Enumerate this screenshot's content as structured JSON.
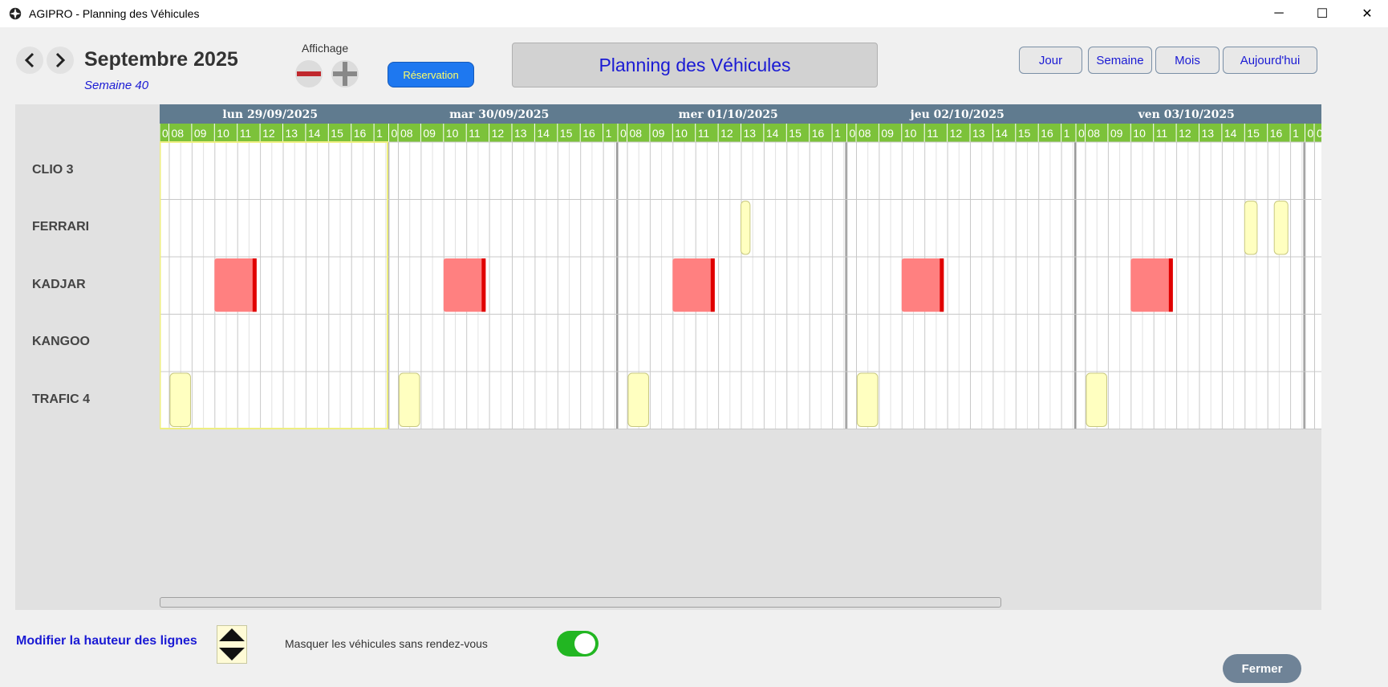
{
  "window": {
    "title": "AGIPRO - Planning des Véhicules",
    "controls": {
      "minimize": "─",
      "maximize": "☐",
      "close": "✕"
    }
  },
  "header": {
    "month_title": "Septembre 2025",
    "week_label": "Semaine 40",
    "display_label": "Affichage",
    "reservation_label": "Réservation",
    "planning_title": "Planning des Véhicules",
    "view_buttons": {
      "day": "Jour",
      "week": "Semaine",
      "month": "Mois",
      "today": "Aujourd'hui"
    }
  },
  "planning": {
    "days": [
      "lun 29/09/2025",
      "mar 30/09/2025",
      "mer 01/10/2025",
      "jeu 02/10/2025",
      "ven 03/10/2025"
    ],
    "hours": [
      "0",
      "08",
      "09",
      "10",
      "11",
      "12",
      "13",
      "14",
      "15",
      "16",
      "1"
    ],
    "vehicles": [
      "CLIO 3",
      "FERRARI",
      "KADJAR",
      "KANGOO",
      "TRAFIC 4"
    ],
    "reservations": [
      {
        "vehicle": "FERRARI",
        "day": 2,
        "start_hour": 13.0,
        "end_hour": 13.4,
        "status": "pending"
      },
      {
        "vehicle": "FERRARI",
        "day": 4,
        "start_hour": 15.0,
        "end_hour": 15.55,
        "status": "pending"
      },
      {
        "vehicle": "FERRARI",
        "day": 4,
        "start_hour": 16.3,
        "end_hour": 16.9,
        "status": "pending"
      },
      {
        "vehicle": "KADJAR",
        "day": 0,
        "start_hour": 10.0,
        "end_hour": 11.85,
        "status": "confirmed"
      },
      {
        "vehicle": "KADJAR",
        "day": 1,
        "start_hour": 10.0,
        "end_hour": 11.85,
        "status": "confirmed"
      },
      {
        "vehicle": "KADJAR",
        "day": 2,
        "start_hour": 10.0,
        "end_hour": 11.85,
        "status": "confirmed"
      },
      {
        "vehicle": "KADJAR",
        "day": 3,
        "start_hour": 10.0,
        "end_hour": 11.85,
        "status": "confirmed"
      },
      {
        "vehicle": "KADJAR",
        "day": 4,
        "start_hour": 10.0,
        "end_hour": 11.85,
        "status": "confirmed"
      },
      {
        "vehicle": "TRAFIC 4",
        "day": 0,
        "start_hour": 8.05,
        "end_hour": 8.95,
        "status": "pending"
      },
      {
        "vehicle": "TRAFIC 4",
        "day": 1,
        "start_hour": 8.05,
        "end_hour": 8.95,
        "status": "pending"
      },
      {
        "vehicle": "TRAFIC 4",
        "day": 2,
        "start_hour": 8.05,
        "end_hour": 8.95,
        "status": "pending"
      },
      {
        "vehicle": "TRAFIC 4",
        "day": 3,
        "start_hour": 8.05,
        "end_hour": 8.95,
        "status": "pending"
      },
      {
        "vehicle": "TRAFIC 4",
        "day": 4,
        "start_hour": 8.05,
        "end_hour": 8.95,
        "status": "pending"
      }
    ]
  },
  "colors": {
    "day_header": "#607b8f",
    "hour_header": "#7cc23a",
    "hour_text": "#ffffff",
    "confirmed_fill": "#ff8080",
    "confirmed_edge": "#e00000",
    "pending_fill": "#ffffc0",
    "pending_border": "#c8c880",
    "selected_day_border": "#eeee80",
    "accent_blue": "#1a1ad4"
  },
  "footer": {
    "row_height_label": "Modifier la hauteur des lignes",
    "hide_label": "Masquer les véhicules sans rendez-vous",
    "hide_toggle_on": true,
    "close_label": "Fermer"
  }
}
